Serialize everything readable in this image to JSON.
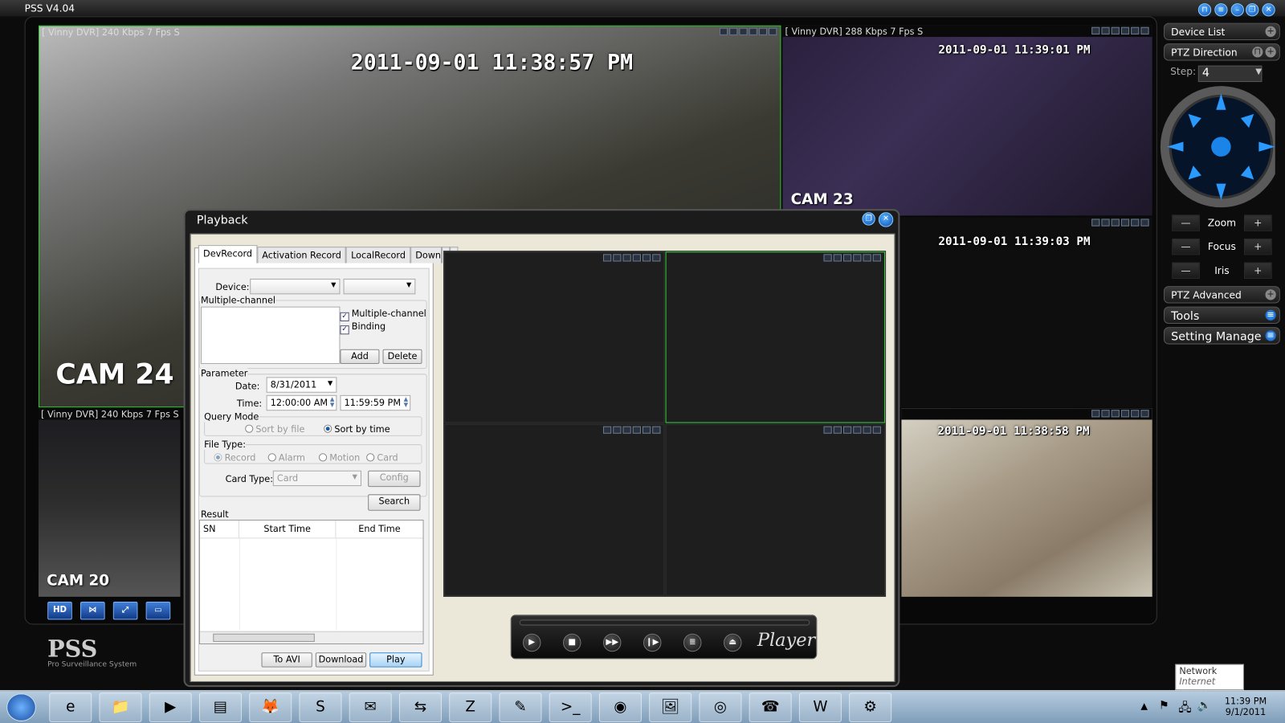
{
  "app": {
    "title": "PSS  V4.04",
    "window_buttons": [
      "lock-icon",
      "menu-icon",
      "minimize-icon",
      "restore-icon",
      "close-icon"
    ]
  },
  "tiles": [
    {
      "label": "[ Vinny DVR] 240 Kbps 7 Fps S",
      "timestamp": "2011-09-01  11:38:57 PM",
      "cam": "CAM 24"
    },
    {
      "label": "[ Vinny DVR] 288 Kbps 7 Fps S",
      "timestamp": "2011-09-01  11:39:01  PM",
      "cam": "CAM 23"
    },
    {
      "label": "",
      "timestamp": "2011-09-01  11:39:03  PM",
      "cam": ""
    },
    {
      "label": "[ Vinny DVR] 240 Kbps 7 Fps S",
      "timestamp": "",
      "cam": "CAM 20"
    },
    {
      "label": "",
      "timestamp": "2011-09-01  11:38:58  PM",
      "cam": ""
    }
  ],
  "toolbar": {
    "hd": "HD"
  },
  "logo": {
    "name": "PSS",
    "sub": "Pro Surveillance System"
  },
  "right_panel": {
    "device_list": "Device List",
    "ptz_direction": "PTZ Direction",
    "step_label": "Step:",
    "step_value": "4",
    "zoom": "Zoom",
    "focus": "Focus",
    "iris": "Iris",
    "minus": "—",
    "plus": "+",
    "ptz_advanced": "PTZ Advanced",
    "tools": "Tools",
    "setting_manage": "Setting Manage"
  },
  "playback": {
    "title": "Playback",
    "tabs": [
      "DevRecord",
      "Activation Record",
      "LocalRecord",
      "Downl"
    ],
    "device_label": "Device:",
    "multi_group": "Multiple-channel",
    "chk_multi": "Multiple-channel",
    "chk_binding": "Binding",
    "add": "Add",
    "delete": "Delete",
    "parameter": "Parameter",
    "date_label": "Date:",
    "date_value": "8/31/2011",
    "time_label": "Time:",
    "time_start": "12:00:00 AM",
    "time_end": "11:59:59 PM",
    "query_mode": "Query Mode",
    "sort_file": "Sort by file",
    "sort_time": "Sort by time",
    "file_type": "File Type:",
    "ft_record": "Record",
    "ft_alarm": "Alarm",
    "ft_motion": "Motion",
    "ft_card": "Card",
    "card_type_label": "Card Type:",
    "card_type_value": "Card",
    "config": "Config",
    "search": "Search",
    "result": "Result",
    "columns": [
      "SN",
      "Start Time",
      "End Time"
    ],
    "to_avi": "To AVI",
    "download": "Download",
    "play": "Play",
    "player_label": "Player"
  },
  "taskbar": {
    "clock_time": "11:39 PM",
    "clock_date": "9/1/2011",
    "apps": [
      "internet-explorer",
      "file-explorer",
      "media-player",
      "document",
      "firefox",
      "skype",
      "thunderbird",
      "teamviewer",
      "filezilla",
      "notepad",
      "command-prompt",
      "media-app",
      "image-viewer",
      "chrome",
      "phone-app",
      "word",
      "remote-app"
    ]
  },
  "tooltip": {
    "title": "Network",
    "sub": "Internet access"
  }
}
